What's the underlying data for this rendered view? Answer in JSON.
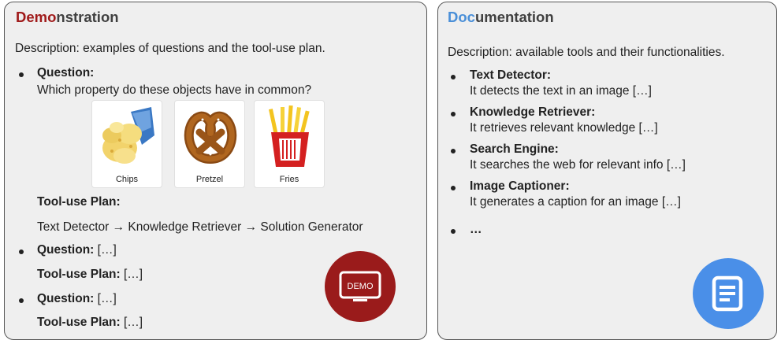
{
  "demonstration": {
    "title_accent": "Demo",
    "title_rest": "nstration",
    "description": "Description: examples of questions and the tool-use plan.",
    "question_label": "Question:",
    "question_text": "Which property do these objects have in common?",
    "images": [
      {
        "caption": "Chips"
      },
      {
        "caption": "Pretzel"
      },
      {
        "caption": "Fries"
      }
    ],
    "plan_label": "Tool-use Plan:",
    "plan_text": "Text Detector → Knowledge Retriever → Solution Generator",
    "more": [
      {
        "question_label": "Question:",
        "question_text": "[…]",
        "plan_label": "Tool-use Plan:",
        "plan_text": "[…]"
      },
      {
        "question_label": "Question:",
        "question_text": "[…]",
        "plan_label": "Tool-use Plan:",
        "plan_text": "[…]"
      }
    ],
    "icon_label": "DEMO",
    "icon_color": "#9a1b1b"
  },
  "documentation": {
    "title_accent": "Doc",
    "title_rest": "umentation",
    "description": "Description: available tools and their functionalities.",
    "tools": [
      {
        "name": "Text Detector:",
        "desc": "It detects the text in an image […]"
      },
      {
        "name": "Knowledge Retriever:",
        "desc": "It retrieves relevant knowledge […]"
      },
      {
        "name": "Search Engine:",
        "desc": "It searches the web for relevant info […]"
      },
      {
        "name": "Image Captioner:",
        "desc": "It generates a caption for an image […]"
      }
    ],
    "ellipsis": "…",
    "icon_name": "document-icon",
    "icon_color": "#4a8fe8"
  }
}
